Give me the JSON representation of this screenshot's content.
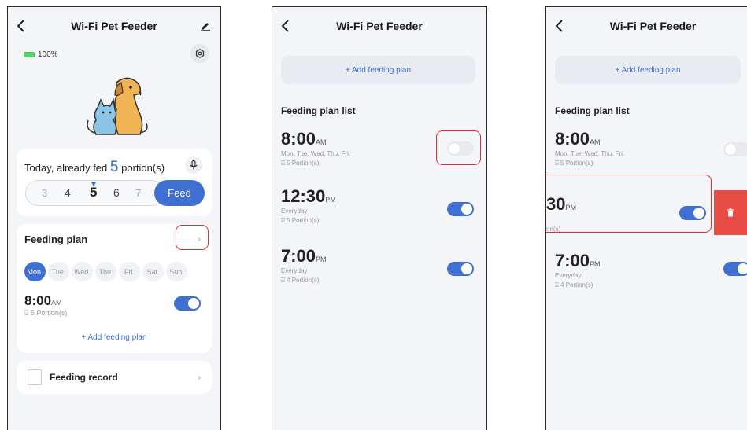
{
  "screen1": {
    "title": "Wi-Fi Pet Feeder",
    "battery": "100%",
    "fed_prefix": "Today, already fed",
    "fed_count": "5",
    "fed_suffix": "portion(s)",
    "picker": [
      "3",
      "4",
      "5",
      "6",
      "7"
    ],
    "feed_button": "Feed",
    "plan_title": "Feeding plan",
    "days": [
      "Mon.",
      "Tue.",
      "Wed.",
      "Thu.",
      "Fri.",
      "Sat.",
      "Sun."
    ],
    "plan_time": "8:00",
    "plan_ampm": "AM",
    "plan_portion": "5 Portion(s)",
    "add_plan": "+ Add feeding plan",
    "record_title": "Feeding record"
  },
  "screen2": {
    "title": "Wi-Fi Pet Feeder",
    "add_plan": "+ Add feeding plan",
    "list_title": "Feeding plan list",
    "items": [
      {
        "time": "8:00",
        "ampm": "AM",
        "days": "Mon. Tue. Wed. Thu. Fri.",
        "portion": "5 Portion(s)"
      },
      {
        "time": "12:30",
        "ampm": "PM",
        "days": "Everyday",
        "portion": "5 Portion(s)"
      },
      {
        "time": "7:00",
        "ampm": "PM",
        "days": "Everyday",
        "portion": "4 Portion(s)"
      }
    ]
  },
  "screen3": {
    "title": "Wi-Fi Pet Feeder",
    "add_plan": "+ Add feeding plan",
    "list_title": "Feeding plan list",
    "item1": {
      "time": "8:00",
      "ampm": "AM",
      "days": "Mon. Tue. Wed. Thu. Fri.",
      "portion": "5 Portion(s)"
    },
    "item2": {
      "time": "30",
      "ampm": "PM",
      "portion": "on(s)"
    },
    "item3": {
      "time": "7:00",
      "ampm": "PM",
      "days": "Everyday",
      "portion": "4 Portion(s)"
    }
  },
  "colors": {
    "accent": "#3f6fd1",
    "delete": "#e94b45",
    "highlight": "#d8342f",
    "battery": "#5bd16a"
  }
}
